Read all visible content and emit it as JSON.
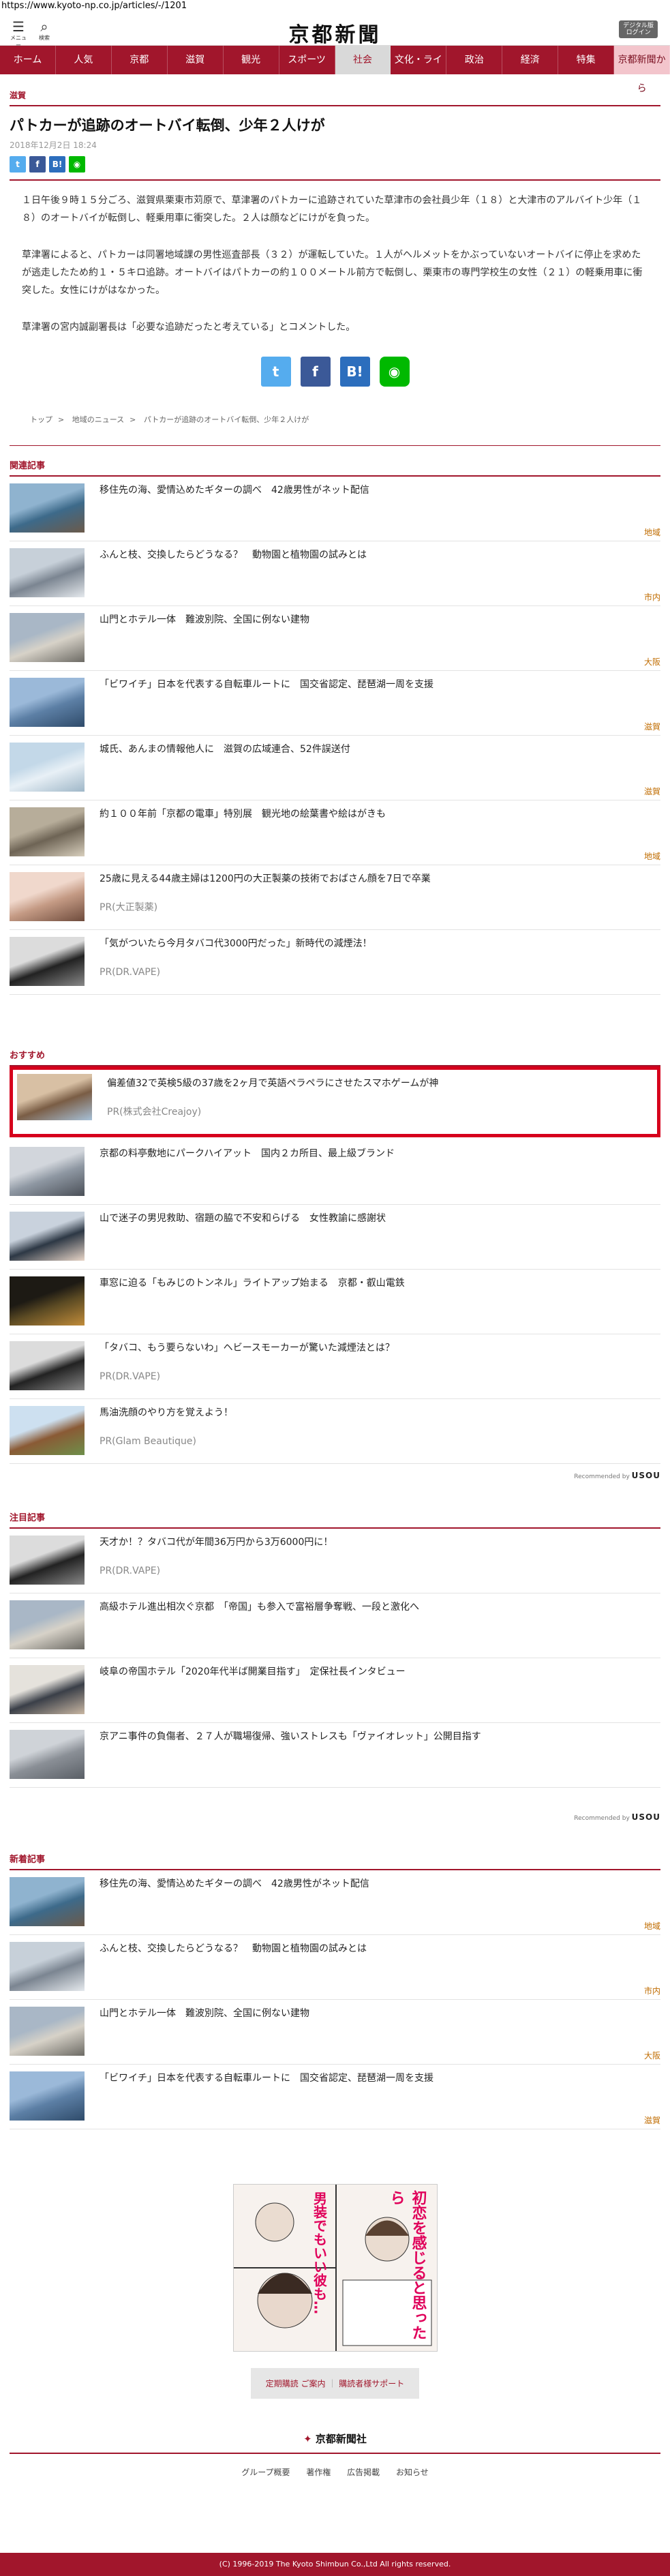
{
  "url": "https://www.kyoto-np.co.jp/articles/-/1201",
  "header": {
    "menu_label": "メニュー",
    "search_label": "検索",
    "logo": "京都新聞",
    "digital_button": "デジタル版\nログイン"
  },
  "nav": [
    "ホーム",
    "人気",
    "京都",
    "滋賀",
    "観光",
    "スポーツ",
    "社会",
    "文化・ライフ",
    "政治",
    "経済",
    "特集",
    "京都新聞から"
  ],
  "nav_active": 6,
  "article": {
    "region": "滋賀",
    "title": "パトカーが追跡のオートバイ転倒、少年２人けが",
    "date": "2018年12月2日 18:24",
    "paragraphs": [
      "１日午後９時１５分ごろ、滋賀県栗東市苅原で、草津署のパトカーに追跡されていた草津市の会社員少年（１８）と大津市のアルバイト少年（１８）のオートバイが転倒し、軽乗用車に衝突した。２人は顔などにけがを負った。",
      "草津署によると、パトカーは同署地域課の男性巡査部長（３２）が運転していた。１人がヘルメットをかぶっていないオートバイに停止を求めたが逃走したため約１・５キロ追跡。オートバイはパトカーの約１００メートル前方で転倒し、栗東市の専門学校生の女性（２１）の軽乗用車に衝突した。女性にけがはなかった。",
      "草津署の宮内誠副署長は「必要な追跡だったと考えている」とコメントした。"
    ]
  },
  "breadcrumb": [
    "トップ",
    "地域のニュース",
    "パトカーが追跡のオートバイ転倒、少年２人けが"
  ],
  "related": {
    "title": "関連記事",
    "items": [
      {
        "text": "移住先の海、愛情込めたギターの調べ　42歳男性がネット配信",
        "tag": "地域",
        "thumb": "sea"
      },
      {
        "text": "ふんと枝、交換したらどうなる？　動物園と植物園の試みとは",
        "tag": "市内",
        "thumb": "town"
      },
      {
        "text": "山門とホテル一体　難波別院、全国に例ない建物",
        "tag": "大阪",
        "thumb": "building"
      },
      {
        "text": "「ビワイチ」日本を代表する自転車ルートに　国交省認定、琵琶湖一周を支援",
        "tag": "滋賀",
        "thumb": "lake"
      },
      {
        "text": "城氏、あんまの情報他人に　滋賀の広域連合、52件誤送付",
        "tag": "滋賀",
        "thumb": "doc"
      },
      {
        "text": "約１００年前「京都の電車」特別展　観光地の絵葉書や絵はがきも",
        "tag": "地域",
        "thumb": "old"
      },
      {
        "text": "25歳に見える44歳主婦は1200円の大正製薬の技術でおばさん顔を7日で卒業",
        "pr": "PR(大正製薬)",
        "thumb": "woman"
      },
      {
        "text": "「気がついたら今月タバコ代3000円だった」新時代の減煙法！",
        "pr": "PR(DR.VAPE)",
        "thumb": "vape"
      }
    ]
  },
  "recommend": {
    "title": "おすすめ",
    "items": [
      {
        "text": "偏差値32で英検5級の37歳を2ヶ月で英語ペラペラにさせたスマホゲームが神",
        "pr": "PR(株式会社Creajoy)",
        "thumb": "people",
        "highlight": true
      },
      {
        "text": "京都の料亭敷地にパークハイアット　国内２カ所目、最上級ブランド",
        "thumb": "hotel"
      },
      {
        "text": "山で迷子の男児救助、宿題の脇で不安和らげる　女性教諭に感謝状",
        "thumb": "girl"
      },
      {
        "text": "車窓に迫る「もみじのトンネル」ライトアップ始まる　京都・叡山電鉄",
        "thumb": "night"
      },
      {
        "text": "「タバコ、もう要らないわ」ヘビースモーカーが驚いた減煙法とは？",
        "pr": "PR(DR.VAPE)",
        "thumb": "vape"
      },
      {
        "text": "馬油洗顔のやり方を覚えよう！",
        "pr": "PR(Glam Beautique)",
        "thumb": "horse"
      }
    ],
    "credit": "Recommended by",
    "credit_brand": "USOU"
  },
  "featured": {
    "title": "注目記事",
    "items": [
      {
        "text": "天才か！？タバコ代が年間36万円から3万6000円に！",
        "pr": "PR(DR.VAPE)",
        "thumb": "vape"
      },
      {
        "text": "高級ホテル進出相次ぐ京都　「帝国」も参入で富裕層争奪戦、一段と激化へ",
        "thumb": "building"
      },
      {
        "text": "岐阜の帝国ホテル「2020年代半ば開業目指す」　定保社長インタビュー",
        "thumb": "man"
      },
      {
        "text": "京アニ事件の負傷者、２７人が職場復帰、強いストレスも「ヴァイオレット」公開目指す",
        "thumb": "office"
      }
    ],
    "credit": "Recommended by",
    "credit_brand": "USOU"
  },
  "latest": {
    "title": "新着記事",
    "items": [
      {
        "text": "移住先の海、愛情込めたギターの調べ　42歳男性がネット配信",
        "tag": "地域",
        "thumb": "sea"
      },
      {
        "text": "ふんと枝、交換したらどうなる？　動物園と植物園の試みとは",
        "tag": "市内",
        "thumb": "town"
      },
      {
        "text": "山門とホテル一体　難波別院、全国に例ない建物",
        "tag": "大阪",
        "thumb": "building"
      },
      {
        "text": "「ビワイチ」日本を代表する自転車ルートに　国交省認定、琵琶湖一周を支援",
        "tag": "滋賀",
        "thumb": "lake"
      }
    ]
  },
  "ad_banner": {
    "line1": "初恋を感じると思ったら",
    "line2": "男装でもいい彼も…"
  },
  "support": {
    "left": "定期購読 ご案内",
    "sep": "｜",
    "right": "購読者様サポート"
  },
  "footer": {
    "logo": "京都新聞社",
    "links": [
      "グループ概要",
      "著作権",
      "広告掲載",
      "お知らせ"
    ],
    "copyright": "(C) 1996-2019 The Kyoto Shimbun Co.,Ltd All rights reserved."
  },
  "colors": {
    "brand": "#a1162c",
    "twitter": "#55acee",
    "facebook": "#3b5998",
    "hatena": "#2c6ebd",
    "line": "#00b900",
    "ad_border": "#d6001c"
  }
}
